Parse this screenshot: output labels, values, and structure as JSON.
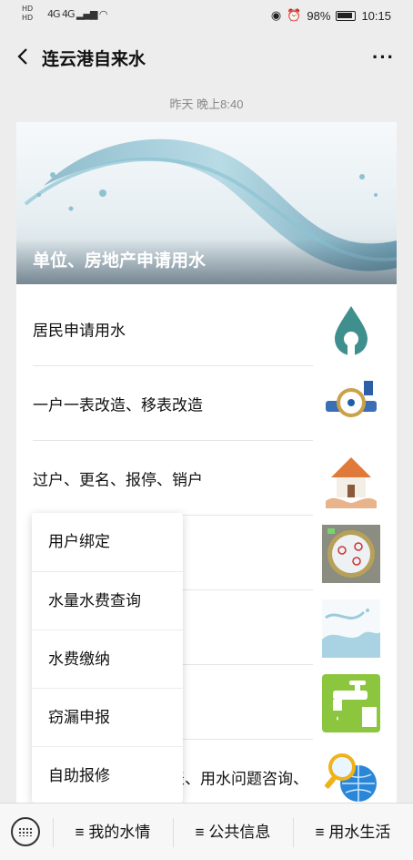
{
  "status_bar": {
    "hd_label": "HD",
    "signal_text": "4G 4G",
    "battery": "98%",
    "time": "10:15"
  },
  "nav": {
    "title": "连云港自来水",
    "more": "···"
  },
  "timestamp": "昨天 晚上8:40",
  "article": {
    "hero_title": "单位、房地产申请用水",
    "items": [
      {
        "label": "居民申请用水",
        "icon": "water-drop-icon"
      },
      {
        "label": "一户一表改造、移表改造",
        "icon": "water-meter-icon"
      },
      {
        "label": "过户、更名、报停、销户",
        "icon": "house-in-hands-icon"
      },
      {
        "label": "",
        "icon": "meter-dial-icon"
      },
      {
        "label": "",
        "icon": "water-splash-icon"
      },
      {
        "label": "",
        "icon": "faucet-icon"
      },
      {
        "label": "表、用水问题咨询、",
        "icon": "globe-magnifier-icon"
      }
    ]
  },
  "popup_menu": {
    "items": [
      "用户绑定",
      "水量水费查询",
      "水费缴纳",
      "窃漏申报",
      "自助报修"
    ]
  },
  "bottom_bar": {
    "tabs": [
      "≡ 我的水情",
      "≡ 公共信息",
      "≡ 用水生活"
    ]
  },
  "colors": {
    "page_bg": "#ededed",
    "card_bg": "#ffffff",
    "faucet_green": "#8cc63f",
    "drop_teal": "#3f8f8f"
  }
}
